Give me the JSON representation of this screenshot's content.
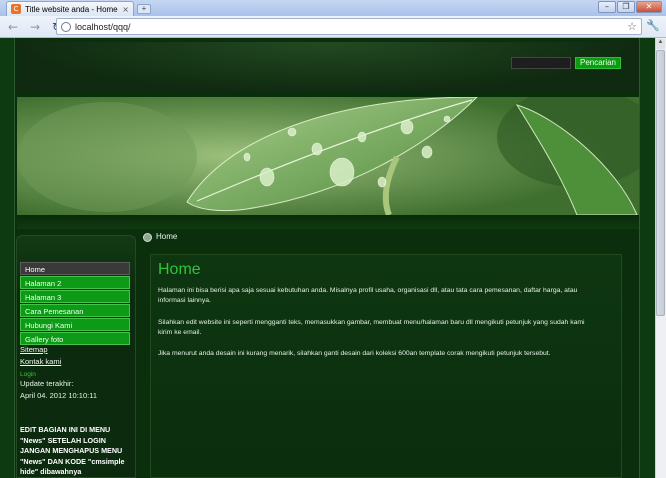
{
  "browser": {
    "tab_title": "Title website anda - Home",
    "tab_close": "×",
    "new_tab": "+",
    "url": "localhost/qqq/",
    "window_buttons": {
      "minimize": "–",
      "restore": "❐",
      "close": "✕"
    },
    "nav": {
      "back": "←",
      "forward": "→",
      "reload": "↻"
    },
    "star": "☆",
    "wrench": "🔧"
  },
  "site": {
    "search_button": "Pencarian",
    "breadcrumb": "Home",
    "menu": [
      {
        "label": "Home",
        "active": true
      },
      {
        "label": "Halaman 2",
        "active": false
      },
      {
        "label": "Halaman 3",
        "active": false
      },
      {
        "label": "Cara Pemesanan",
        "active": false
      },
      {
        "label": "Hubungi Kami",
        "active": false
      },
      {
        "label": "Gallery foto",
        "active": false
      }
    ],
    "sitemap": "Sitemap",
    "contact": "Kontak kami",
    "login": "Login",
    "updated_label": "Update terakhir:",
    "updated_date": "April 04. 2012 10:10:11",
    "edit_notice": "EDIT BAGIAN INI DI MENU \"News\" SETELAH LOGIN JANGAN MENGHAPUS MENU \"News\" DAN KODE \"cmsimple hide\" dibawahnya",
    "page_title": "Home",
    "paragraphs": [
      "Halaman ini bisa berisi apa saja sesuai kebutuhan anda. Misalnya profil usaha, organisasi dll, atau tata cara pemesanan, daftar harga, atau informasi lainnya.",
      "Silahkan edit website ini seperti mengganti teks, memasukkan gambar, membuat menu/halaman baru dll mengikuti petunjuk yang sudah kami kirim ke email.",
      "Jika menurut anda desain ini kurang menarik, silahkan ganti desain dari koleksi 600an template corak mengikuti petunjuk tersebut."
    ]
  },
  "colors": {
    "accent": "#0d9a16",
    "title": "#31c43a",
    "background": "#0b2e0d"
  }
}
